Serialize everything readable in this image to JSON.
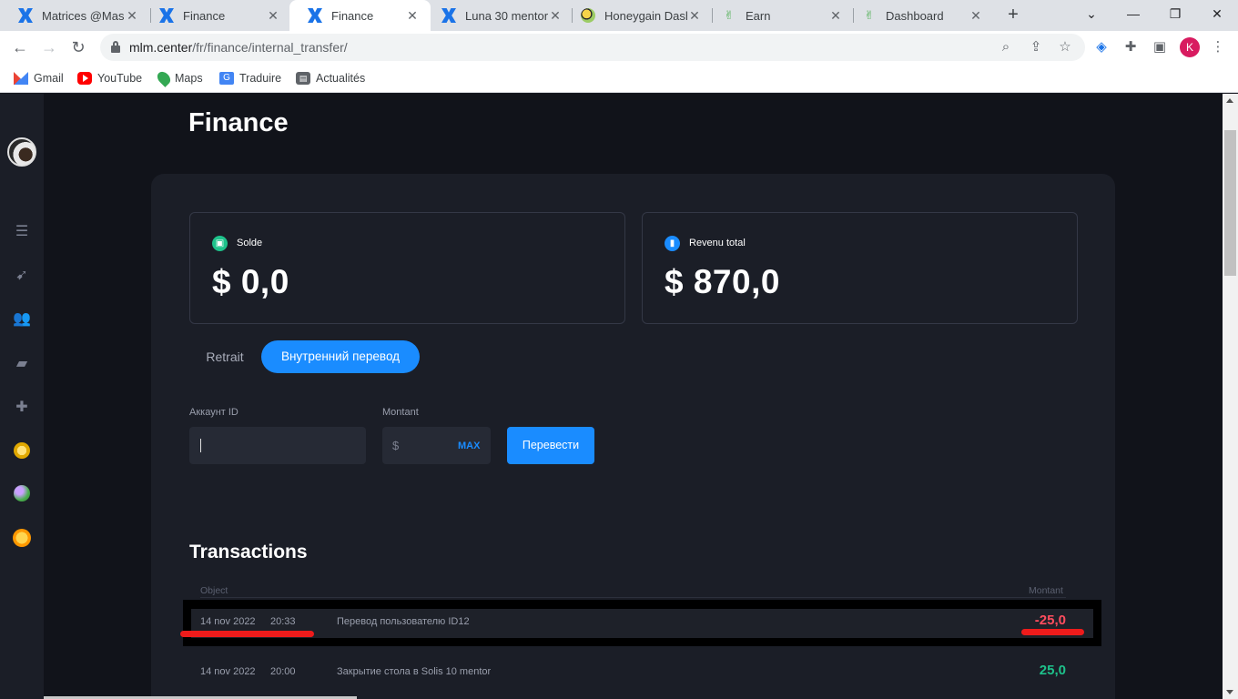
{
  "browser": {
    "tabs": [
      {
        "title": "Matrices @Maser",
        "icon": "blue-x-icon",
        "active": false
      },
      {
        "title": "Finance",
        "icon": "blue-x-icon",
        "active": false
      },
      {
        "title": "Finance",
        "icon": "blue-x-icon",
        "active": true
      },
      {
        "title": "Luna 30 mentor",
        "icon": "blue-x-icon",
        "active": false
      },
      {
        "title": "Honeygain Dashb",
        "icon": "honeygain-icon",
        "active": false
      },
      {
        "title": "Earn",
        "icon": "earn-icon",
        "active": false
      },
      {
        "title": "Dashboard",
        "icon": "earn-icon",
        "active": false
      }
    ],
    "url_host": "mlm.center",
    "url_path": "/fr/finance/internal_transfer/",
    "profile_initial": "K",
    "bookmarks": [
      "Gmail",
      "YouTube",
      "Maps",
      "Traduire",
      "Actualités"
    ]
  },
  "page": {
    "title": "Finance",
    "balance": {
      "label": "Solde",
      "value": "$ 0,0"
    },
    "total_income": {
      "label": "Revenu total",
      "value": "$ 870,0"
    },
    "tabs": {
      "withdraw": "Retrait",
      "internal": "Внутренний перевод"
    },
    "form": {
      "account_label": "Аккаунт ID",
      "account_value": "",
      "amount_label": "Montant",
      "currency": "$",
      "max": "MAX",
      "submit": "Перевести"
    },
    "transactions": {
      "title": "Transactions",
      "col_object": "Object",
      "col_amount": "Montant",
      "rows": [
        {
          "date": "14 nov 2022",
          "time": "20:33",
          "object": "Перевод пользователю ID12",
          "amount": "-25,0"
        },
        {
          "date": "14 nov 2022",
          "time": "20:00",
          "object": "Закрытие стола в Solis 10 mentor",
          "amount": "25,0"
        }
      ]
    }
  },
  "colors": {
    "accent": "#1a8cff",
    "negative": "#ff4d5e",
    "positive": "#1ec28b",
    "annotation": "#ee1b1b"
  }
}
